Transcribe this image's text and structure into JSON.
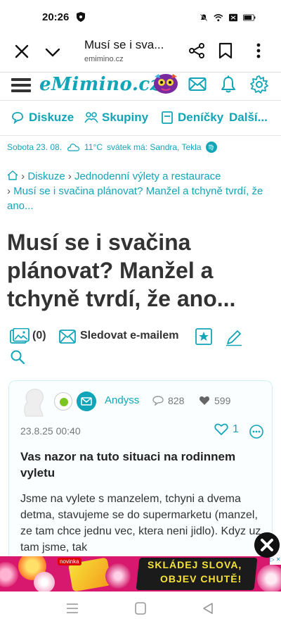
{
  "status_bar": {
    "time": "20:26"
  },
  "browser": {
    "page_title": "Musí se i sva...",
    "domain": "emimino.cz"
  },
  "site": {
    "logo": "eMimino.cz"
  },
  "nav": {
    "items": [
      "Diskuze",
      "Skupiny",
      "Deníčky",
      "Další..."
    ]
  },
  "info_line": {
    "text": "Sobota 23. 08.",
    "temp": "11°C",
    "nameday": "svátek má: Sandra, Tekla"
  },
  "breadcrumb": {
    "items": [
      "Diskuze",
      "Jednodenní výlety a restaurace",
      "Musí se i svačina plánovat? Manžel a tchyně tvrdí, že ano..."
    ]
  },
  "article": {
    "title": "Musí se i svačina plánovat? Manžel a tchyně tvrdí, že ano..."
  },
  "actions": {
    "photo_count": "(0)",
    "follow_label": "Sledovat e-mailem"
  },
  "post": {
    "username": "Andyss",
    "comments": "828",
    "hearts": "599",
    "date": "23.8.25 00:40",
    "likes": "1",
    "title": "Vas nazor na tuto situaci na rodinnem vyletu",
    "body": "Jsme na vylete s manzelem, tchyni a dvema detma, stavujeme se do supermarketu (manzel, ze tam chce jednu vec, ktera neni jidlo). Kdyz uz tam jsme, tak"
  },
  "ad": {
    "line1": "SKLÁDEJ SLOVA,",
    "line2": "OBJEV CHUTĚ!",
    "badge": "novinka",
    "info": "▷ ✕"
  },
  "colors": {
    "accent": "#12a5b8",
    "ad_bg": "#d8186f"
  }
}
